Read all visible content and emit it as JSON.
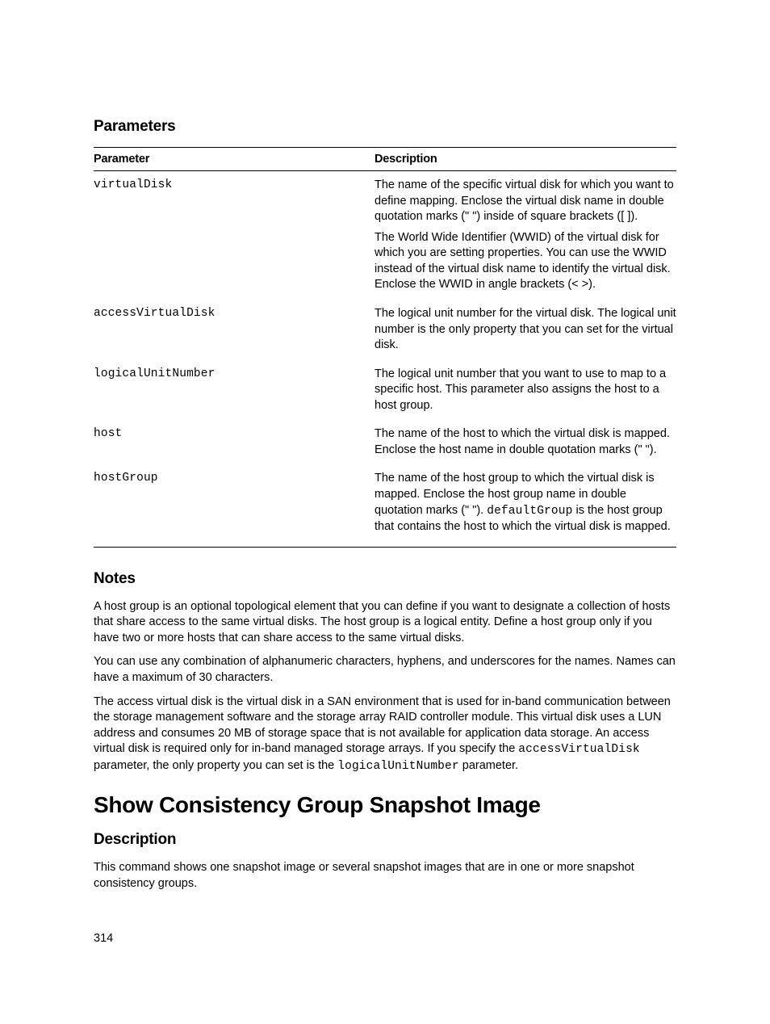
{
  "sections": {
    "parameters_heading": "Parameters",
    "notes_heading": "Notes",
    "topic_heading": "Show Consistency Group Snapshot Image",
    "description_heading": "Description"
  },
  "table": {
    "col_param": "Parameter",
    "col_desc": "Description",
    "rows": [
      {
        "param": "virtualDisk",
        "desc": [
          "The name of the specific virtual disk for which you want to define mapping. Enclose the virtual disk name in double quotation marks (\" \") inside of square brackets ([ ]).",
          "The World Wide Identifier (WWID) of the virtual disk for which you are setting properties. You can use the WWID instead of the virtual disk name to identify the virtual disk. Enclose the WWID in angle brackets (< >)."
        ],
        "desc_inline_code": null
      },
      {
        "param": "accessVirtualDisk",
        "desc": [
          "The logical unit number for the virtual disk. The logical unit number is the only property that you can set for the virtual disk."
        ],
        "desc_inline_code": null
      },
      {
        "param": "logicalUnitNumber",
        "desc": [
          "The logical unit number that you want to use to map to a specific host. This parameter also assigns the host to a host group."
        ],
        "desc_inline_code": null
      },
      {
        "param": "host",
        "desc": [
          "The name of the host to which the virtual disk is mapped. Enclose the host name in double quotation marks (\" \")."
        ],
        "desc_inline_code": null
      },
      {
        "param": "hostGroup",
        "desc_pre": "The name of the host group to which the virtual disk is mapped. Enclose the host group name in double quotation marks (\" \"). ",
        "desc_code": "defaultGroup",
        "desc_post": " is the host group that contains the host to which the virtual disk is mapped."
      }
    ]
  },
  "notes": {
    "p1": "A host group is an optional topological element that you can define if you want to designate a collection of hosts that share access to the same virtual disks. The host group is a logical entity. Define a host group only if you have two or more hosts that can share access to the same virtual disks.",
    "p2": "You can use any combination of alphanumeric characters, hyphens, and underscores for the names. Names can have a maximum of 30 characters.",
    "p3_pre": "The access virtual disk is the virtual disk in a SAN environment that is used for in-band communication between the storage management software and the storage array RAID controller module. This virtual disk uses a LUN address and consumes 20 MB of storage space that is not available for application data storage. An access virtual disk is required only for in-band managed storage arrays. If you specify the ",
    "p3_code1": "accessVirtualDisk",
    "p3_mid": " parameter, the only property you can set is the ",
    "p3_code2": "logicalUnitNumber",
    "p3_post": " parameter."
  },
  "description_body": "This command shows one snapshot image or several snapshot images that are in one or more snapshot consistency groups.",
  "page_number": "314"
}
